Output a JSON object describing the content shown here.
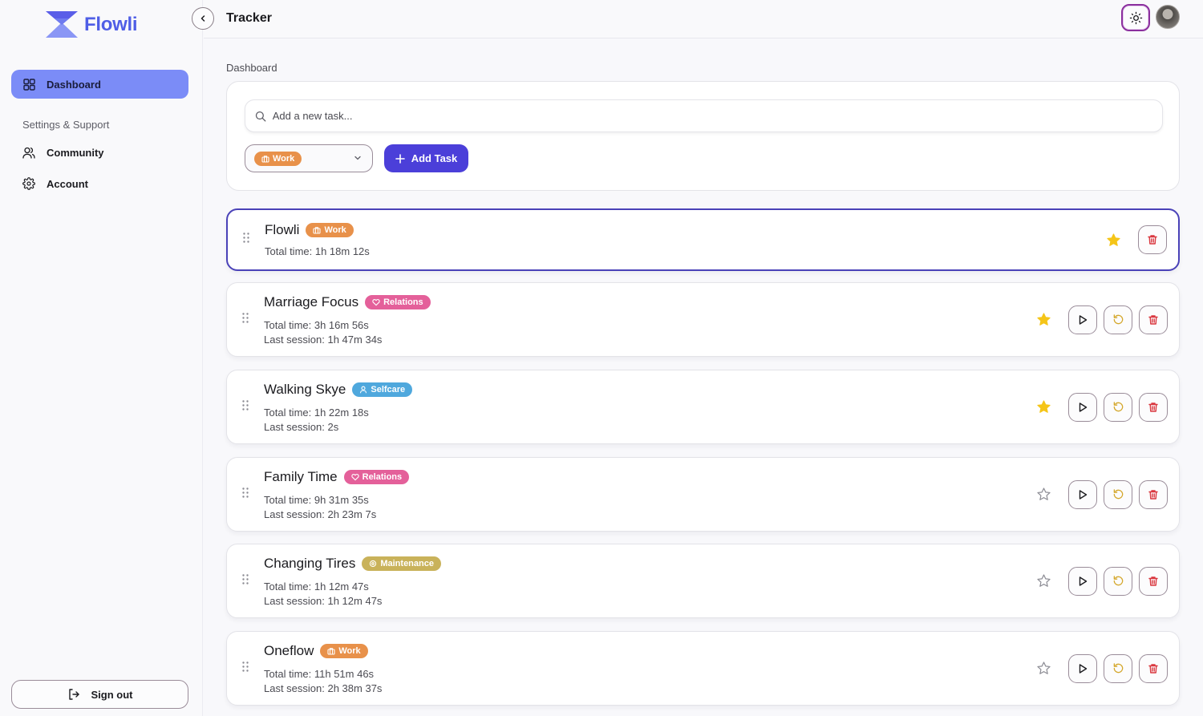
{
  "app": {
    "name": "Flowli"
  },
  "sidebar": {
    "items": [
      {
        "label": "Dashboard",
        "icon": "grid-icon",
        "active": true
      }
    ],
    "section_label": "Settings & Support",
    "support_items": [
      {
        "label": "Community",
        "icon": "users-icon"
      },
      {
        "label": "Account",
        "icon": "gear-icon"
      }
    ],
    "sign_out_label": "Sign out"
  },
  "header": {
    "title": "Tracker",
    "theme_icon": "sun-icon",
    "avatar": "user-avatar"
  },
  "breadcrumb": "Dashboard",
  "new_task": {
    "placeholder": "Add a new task...",
    "value": "",
    "selected_category": {
      "label": "Work",
      "icon": "briefcase-icon",
      "color": "#e8914a"
    },
    "add_label": "Add Task"
  },
  "colors": {
    "accent": "#4b3fd9",
    "sidebar_active": "#7b8cf7",
    "star_filled": "#f5c518",
    "delete": "#d9363e",
    "reset": "#d4a72c"
  },
  "tasks": [
    {
      "name": "Flowli",
      "category": "Work",
      "category_icon": "briefcase-icon",
      "category_color": "#e8914a",
      "total": "Total time: 1h 18m 12s",
      "last": "",
      "starred": true,
      "selected": true
    },
    {
      "name": "Marriage Focus",
      "category": "Relations",
      "category_icon": "heart-icon",
      "category_color": "#e4609a",
      "total": "Total time: 3h 16m 56s",
      "last": "Last session: 1h 47m 34s",
      "starred": true,
      "selected": false
    },
    {
      "name": "Walking Skye",
      "category": "Selfcare",
      "category_icon": "person-icon",
      "category_color": "#4fa8dd",
      "total": "Total time: 1h 22m 18s",
      "last": "Last session: 2s",
      "starred": true,
      "selected": false
    },
    {
      "name": "Family Time",
      "category": "Relations",
      "category_icon": "heart-icon",
      "category_color": "#e4609a",
      "total": "Total time: 9h 31m 35s",
      "last": "Last session: 2h 23m 7s",
      "starred": false,
      "selected": false
    },
    {
      "name": "Changing Tires",
      "category": "Maintenance",
      "category_icon": "gear-icon",
      "category_color": "#c9b25a",
      "total": "Total time: 1h 12m 47s",
      "last": "Last session: 1h 12m 47s",
      "starred": false,
      "selected": false
    },
    {
      "name": "Oneflow",
      "category": "Work",
      "category_icon": "briefcase-icon",
      "category_color": "#e8914a",
      "total": "Total time: 11h 51m 46s",
      "last": "Last session: 2h 38m 37s",
      "starred": false,
      "selected": false
    }
  ]
}
